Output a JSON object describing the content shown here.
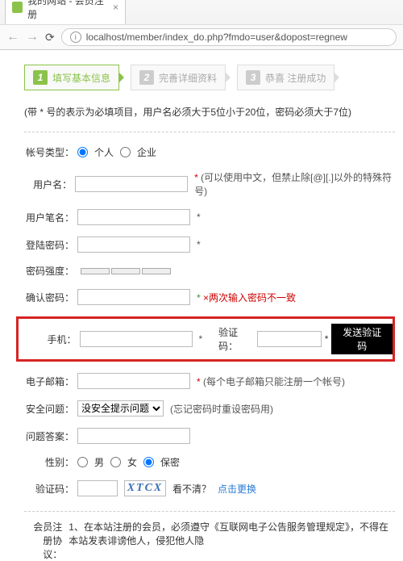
{
  "browser": {
    "tab_title": "我的网站 - 会员注册",
    "url": "localhost/member/index_do.php?fmdo=user&dopost=regnew"
  },
  "steps": {
    "s1": "填写基本信息",
    "s2": "完善详细资料",
    "s3": "恭喜 注册成功"
  },
  "top_note": "(带 * 号的表示为必填项目，用户名必须大于5位小于20位，密码必须大于7位)",
  "labels": {
    "account_type": "帐号类型：",
    "personal": "个人",
    "company": "企业",
    "username": "用户名：",
    "nickname": "用户笔名：",
    "password": "登陆密码：",
    "strength": "密码强度：",
    "confirm": "确认密码：",
    "phone": "手机：",
    "vcode": "验证码：",
    "email": "电子邮箱：",
    "question": "安全问题：",
    "answer": "问题答案：",
    "gender": "性别：",
    "captcha": "验证码：",
    "agreement_label": "会员注册协议："
  },
  "hints": {
    "username": "(可以使用中文，但禁止除[@][.]以外的特殊符号)",
    "confirm_error": "×两次输入密码不一致",
    "email": "(每个电子邮箱只能注册一个帐号)",
    "question": "(忘记密码时重设密码用)",
    "captcha_refresh_q": "看不清？",
    "captcha_refresh_link": "点击更换"
  },
  "options": {
    "question_none": "没安全提示问题",
    "gender_male": "男",
    "gender_female": "女",
    "gender_secret": "保密"
  },
  "buttons": {
    "send_code": "发送验证码"
  },
  "captcha_text": "XTCX",
  "agreement_text": "1、在本站注册的会员，必须遵守《互联网电子公告服务管理规定》，不得在本站发表诽谤他人，侵犯他人隐"
}
